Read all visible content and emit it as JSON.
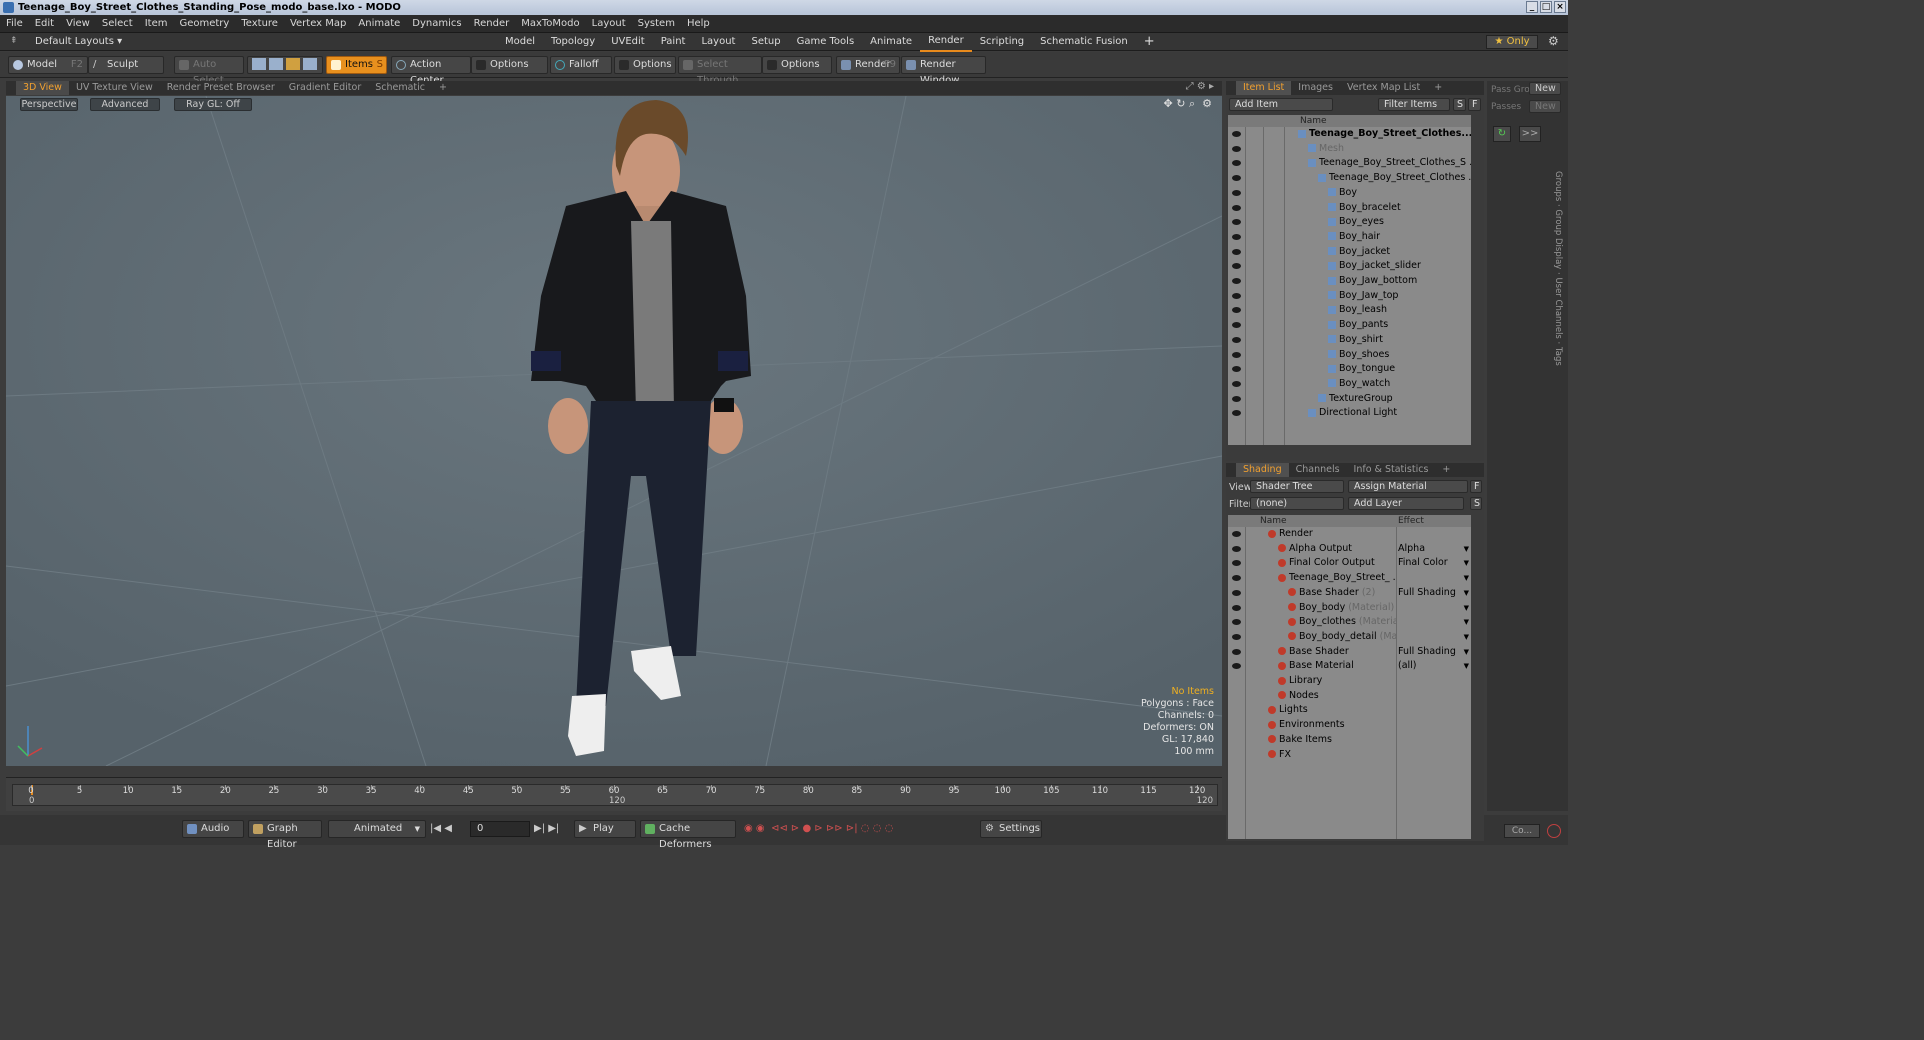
{
  "window": {
    "title": "Teenage_Boy_Street_Clothes_Standing_Pose_modo_base.lxo - MODO"
  },
  "menu": [
    "File",
    "Edit",
    "View",
    "Select",
    "Item",
    "Geometry",
    "Texture",
    "Vertex Map",
    "Animate",
    "Dynamics",
    "Render",
    "MaxToModo",
    "Layout",
    "System",
    "Help"
  ],
  "layout": {
    "default_label": "Default Layouts ▾",
    "tabs": [
      "Model",
      "Topology",
      "UVEdit",
      "Paint",
      "Layout",
      "Setup",
      "Game Tools",
      "Animate",
      "Render",
      "Scripting",
      "Schematic Fusion"
    ],
    "active_tab": "Render",
    "add": "+",
    "only_label": "★ Only"
  },
  "toolbar": {
    "model": "Model",
    "model_key": "F2",
    "sculpt": "Sculpt",
    "auto_select": "Auto Select",
    "items": "Items",
    "items_key": "S",
    "action_center": "Action Center",
    "options1": "Options",
    "falloff": "Falloff",
    "options2": "Options",
    "select_through": "Select Through",
    "options3": "Options",
    "render": "Render",
    "render_key": "F9",
    "render_window": "Render Window"
  },
  "viewtabs": [
    "3D View",
    "UV Texture View",
    "Render Preset Browser",
    "Gradient Editor",
    "Schematic",
    "+"
  ],
  "viewport": {
    "perspective": "Perspective",
    "advanced": "Advanced",
    "raygl": "Ray GL: Off",
    "hud": {
      "no_items": "No Items",
      "polygons": "Polygons : Face",
      "channels": "Channels: 0",
      "deformers": "Deformers: ON",
      "gl": "GL: 17,840",
      "size": "100 mm"
    }
  },
  "timeline": {
    "ticks": [
      "0",
      "5",
      "10",
      "15",
      "20",
      "25",
      "30",
      "35",
      "40",
      "45",
      "50",
      "55",
      "60",
      "65",
      "70",
      "75",
      "80",
      "85",
      "90",
      "95",
      "100",
      "105",
      "110",
      "115",
      "120"
    ],
    "start": "0",
    "mid": "120",
    "end": "120"
  },
  "bottom": {
    "audio": "Audio",
    "graph_editor": "Graph Editor",
    "animated": "Animated",
    "frame": "0",
    "play": "Play",
    "cache": "Cache Deformers",
    "settings": "Settings",
    "co": "Co..."
  },
  "itemlist": {
    "tabs": [
      "Item List",
      "Images",
      "Vertex Map List",
      "+"
    ],
    "add_item": "Add Item",
    "filter_items": "Filter Items",
    "s": "S",
    "f": "F",
    "name_header": "Name",
    "items": [
      {
        "label": "Teenage_Boy_Street_Clothes...",
        "indent": 0,
        "bold": true
      },
      {
        "label": "Mesh",
        "indent": 1,
        "dim": true
      },
      {
        "label": "Teenage_Boy_Street_Clothes_S ...",
        "indent": 1
      },
      {
        "label": "Teenage_Boy_Street_Clothes ...",
        "indent": 2
      },
      {
        "label": "Boy",
        "indent": 3
      },
      {
        "label": "Boy_bracelet",
        "indent": 3
      },
      {
        "label": "Boy_eyes",
        "indent": 3
      },
      {
        "label": "Boy_hair",
        "indent": 3
      },
      {
        "label": "Boy_jacket",
        "indent": 3
      },
      {
        "label": "Boy_jacket_slider",
        "indent": 3
      },
      {
        "label": "Boy_Jaw_bottom",
        "indent": 3
      },
      {
        "label": "Boy_Jaw_top",
        "indent": 3
      },
      {
        "label": "Boy_leash",
        "indent": 3
      },
      {
        "label": "Boy_pants",
        "indent": 3
      },
      {
        "label": "Boy_shirt",
        "indent": 3
      },
      {
        "label": "Boy_shoes",
        "indent": 3
      },
      {
        "label": "Boy_tongue",
        "indent": 3
      },
      {
        "label": "Boy_watch",
        "indent": 3
      },
      {
        "label": "TextureGroup",
        "indent": 2
      },
      {
        "label": "Directional Light",
        "indent": 1
      }
    ]
  },
  "shading": {
    "tabs": [
      "Shading",
      "Channels",
      "Info & Statistics",
      "+"
    ],
    "view_label": "View",
    "view_value": "Shader Tree",
    "assign_material": "Assign Material",
    "f": "F",
    "filter_label": "Filter",
    "filter_value": "(none)",
    "add_layer": "Add Layer",
    "s": "S",
    "name_header": "Name",
    "effect_header": "Effect",
    "rows": [
      {
        "label": "Render",
        "sub": "",
        "effect": "",
        "indent": 0
      },
      {
        "label": "Alpha Output",
        "sub": "",
        "effect": "Alpha",
        "indent": 1
      },
      {
        "label": "Final Color Output",
        "sub": "",
        "effect": "Final Color",
        "indent": 1
      },
      {
        "label": "Teenage_Boy_Street_ ...",
        "sub": "",
        "effect": "",
        "indent": 1
      },
      {
        "label": "Base Shader",
        "sub": "(2)",
        "effect": "Full Shading",
        "indent": 2
      },
      {
        "label": "Boy_body",
        "sub": "(Material)",
        "effect": "",
        "indent": 2
      },
      {
        "label": "Boy_clothes",
        "sub": "(Material)",
        "effect": "",
        "indent": 2
      },
      {
        "label": "Boy_body_detail",
        "sub": "(Ma...",
        "effect": "",
        "indent": 2
      },
      {
        "label": "Base Shader",
        "sub": "",
        "effect": "Full Shading",
        "indent": 1
      },
      {
        "label": "Base Material",
        "sub": "",
        "effect": "(all)",
        "indent": 1
      },
      {
        "label": "Library",
        "sub": "",
        "effect": "",
        "indent": 1
      },
      {
        "label": "Nodes",
        "sub": "",
        "effect": "",
        "indent": 1
      },
      {
        "label": "Lights",
        "sub": "",
        "effect": "",
        "indent": 0
      },
      {
        "label": "Environments",
        "sub": "",
        "effect": "",
        "indent": 0
      },
      {
        "label": "Bake Items",
        "sub": "",
        "effect": "",
        "indent": 0
      },
      {
        "label": "FX",
        "sub": "",
        "effect": "",
        "indent": 0
      }
    ]
  },
  "pass": {
    "pass_label": "Pass Gro",
    "passes_label": "Passes",
    "new1": "New",
    "new2": "New",
    "more": ">>",
    "side_tabs": [
      "Groups",
      "Group Display",
      "User Channels",
      "Tags"
    ]
  }
}
